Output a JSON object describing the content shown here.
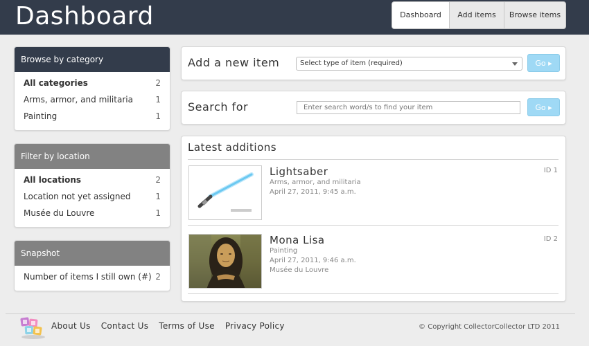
{
  "header": {
    "title": "Dashboard",
    "tabs": [
      {
        "label": "Dashboard",
        "active": true
      },
      {
        "label": "Add items",
        "active": false
      },
      {
        "label": "Browse items",
        "active": false
      }
    ]
  },
  "sidebar": {
    "category": {
      "heading": "Browse by category",
      "items": [
        {
          "label": "All categories",
          "count": "2"
        },
        {
          "label": "Arms, armor, and militaria",
          "count": "1"
        },
        {
          "label": "Painting",
          "count": "1"
        }
      ]
    },
    "location": {
      "heading": "Filter by location",
      "items": [
        {
          "label": "All locations",
          "count": "2"
        },
        {
          "label": "Location not yet assigned",
          "count": "1"
        },
        {
          "label": "Musée du Louvre",
          "count": "1"
        }
      ]
    },
    "snapshot": {
      "heading": "Snapshot",
      "items": [
        {
          "label": "Number of items I still own (#)",
          "count": "2"
        }
      ]
    }
  },
  "add_item": {
    "title": "Add a new item",
    "select_value": "Select type of item (required)",
    "go_label": "Go ▸"
  },
  "search": {
    "title": "Search for",
    "placeholder": "Enter search word/s to find your item",
    "go_label": "Go ▸"
  },
  "latest": {
    "title": "Latest additions",
    "items": [
      {
        "title": "Lightsaber",
        "id": "ID 1",
        "category": "Arms, armor, and militaria",
        "date": "April 27, 2011, 9:45 a.m.",
        "location": ""
      },
      {
        "title": "Mona Lisa",
        "id": "ID 2",
        "category": "Painting",
        "date": "April 27, 2011, 9:46 a.m.",
        "location": "Musée du Louvre"
      }
    ]
  },
  "footer": {
    "links": [
      "About Us",
      "Contact Us",
      "Terms of Use",
      "Privacy Policy"
    ],
    "copyright": "© Copyright CollectorCollector LTD 2011"
  },
  "colors": {
    "header_bg": "#333c4b",
    "accent_button": "#9fd9f5",
    "panel_gray": "#828282"
  }
}
